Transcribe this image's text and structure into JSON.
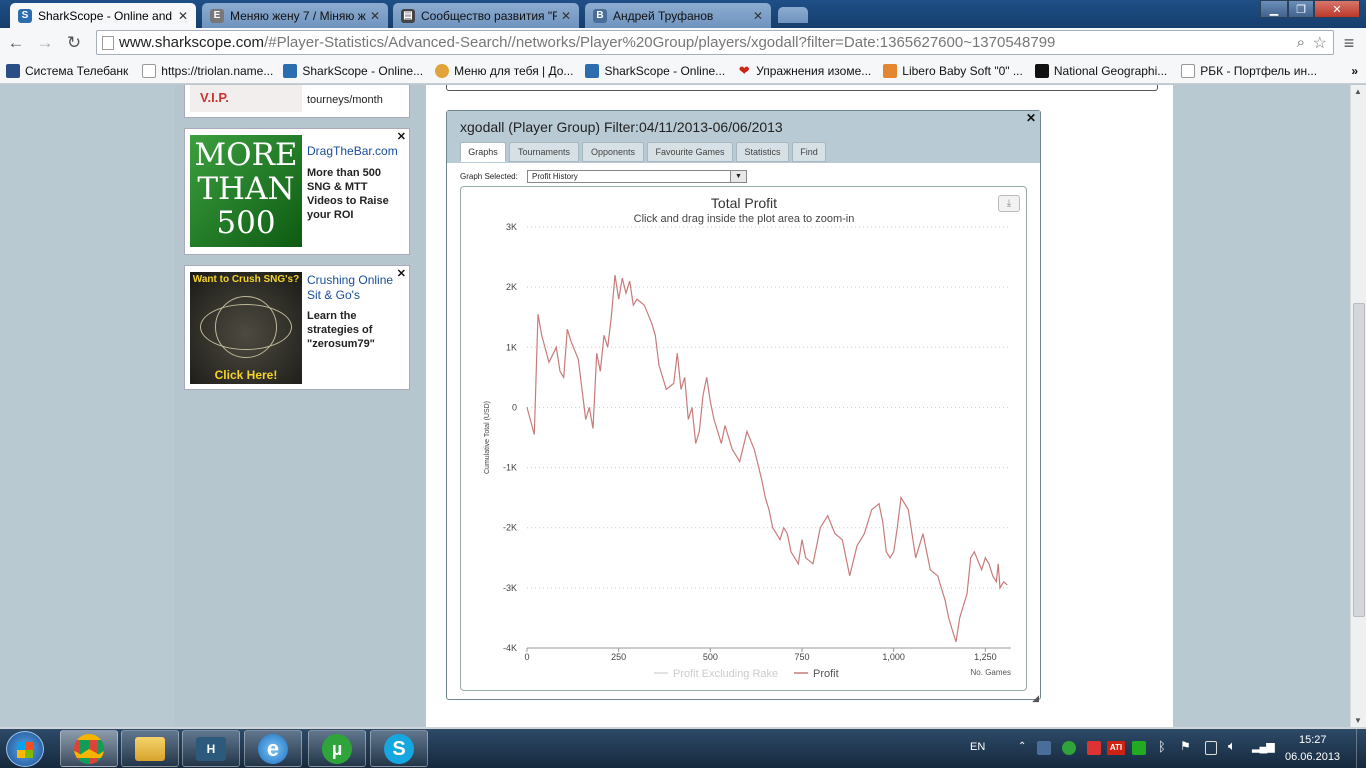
{
  "browser": {
    "tabs": [
      {
        "title": "SharkScope - Online and L",
        "active": true
      },
      {
        "title": "Меняю жену 7 / Міняю ж",
        "active": false
      },
      {
        "title": "Сообщество развития \"R",
        "active": false
      },
      {
        "title": "Андрей Труфанов",
        "active": false
      }
    ],
    "url_host": "www.sharkscope.com",
    "url_path": "/#Player-Statistics/Advanced-Search//networks/Player%20Group/players/xgodall?filter=Date:1365627600~1370548799",
    "bookmarks": [
      "Система Телебанк",
      "https://triolan.name...",
      "SharkScope - Online...",
      "Меню для тебя | До...",
      "SharkScope - Online...",
      "Упражнения изоме...",
      "Libero Baby Soft \"0\" ...",
      "National Geographi...",
      "РБК - Портфель ин..."
    ]
  },
  "ads": [
    {
      "title": "",
      "desc": "tourneys/month",
      "image_text": "V.I.P."
    },
    {
      "title": "DragTheBar.com",
      "desc": "More than 500 SNG & MTT Videos to Raise your ROI",
      "image_text": "MORE THAN 500"
    },
    {
      "title": "Crushing Online Sit & Go's",
      "desc": "Learn the strategies of \"zerosum79\"",
      "image_text_top": "Want to Crush SNG's?",
      "image_text_bottom": "Click Here!"
    }
  ],
  "panel": {
    "title": "xgodall (Player Group) Filter:04/11/2013-06/06/2013",
    "tabs": [
      "Graphs",
      "Tournaments",
      "Opponents",
      "Favourite Games",
      "Statistics",
      "Find"
    ],
    "graph_selected_label": "Graph Selected:",
    "graph_selected_value": "Profit History"
  },
  "chart_data": {
    "type": "line",
    "title": "Total Profit",
    "subtitle": "Click and drag inside the plot area to zoom-in",
    "ylabel": "Cumulative Total (USD)",
    "xlabel": "No. Games",
    "xlim": [
      0,
      1320
    ],
    "ylim": [
      -4000,
      3000
    ],
    "x_ticks": [
      "0",
      "250",
      "500",
      "750",
      "1,000",
      "1,250"
    ],
    "x_tick_values": [
      0,
      250,
      500,
      750,
      1000,
      1250
    ],
    "y_ticks": [
      "3K",
      "2K",
      "1K",
      "0",
      "-1K",
      "-2K",
      "-3K",
      "-4K"
    ],
    "y_tick_values": [
      3000,
      2000,
      1000,
      0,
      -1000,
      -2000,
      -3000,
      -4000
    ],
    "grid": true,
    "legend": "bottom-center",
    "series": [
      {
        "name": "Profit Excluding Rake",
        "color": "#d9d9d9",
        "x": [],
        "y": []
      },
      {
        "name": "Profit",
        "color": "#c87b7b",
        "x": [
          0,
          20,
          30,
          40,
          60,
          80,
          90,
          100,
          110,
          120,
          140,
          160,
          170,
          180,
          190,
          200,
          210,
          220,
          230,
          240,
          250,
          260,
          270,
          280,
          290,
          300,
          320,
          340,
          350,
          360,
          380,
          400,
          410,
          420,
          430,
          440,
          450,
          460,
          470,
          480,
          490,
          500,
          510,
          520,
          530,
          540,
          560,
          580,
          600,
          620,
          640,
          650,
          660,
          670,
          690,
          700,
          710,
          720,
          740,
          750,
          760,
          780,
          800,
          820,
          840,
          860,
          880,
          900,
          920,
          940,
          960,
          970,
          980,
          990,
          1000,
          1010,
          1020,
          1040,
          1050,
          1060,
          1070,
          1080,
          1100,
          1120,
          1130,
          1140,
          1150,
          1160,
          1170,
          1180,
          1190,
          1200,
          1210,
          1220,
          1240,
          1250,
          1260,
          1270,
          1280,
          1285,
          1290,
          1300,
          1310
        ],
        "y": [
          0,
          -450,
          1550,
          1200,
          750,
          1000,
          600,
          500,
          1300,
          1100,
          800,
          -200,
          0,
          -350,
          900,
          600,
          1200,
          1000,
          1500,
          2200,
          1800,
          2150,
          1900,
          2100,
          1700,
          1800,
          1700,
          1400,
          1200,
          700,
          300,
          400,
          900,
          300,
          500,
          -200,
          0,
          -600,
          -400,
          200,
          500,
          100,
          -200,
          -400,
          -600,
          -300,
          -700,
          -900,
          -400,
          -700,
          -1200,
          -1500,
          -1700,
          -2000,
          -2200,
          -2000,
          -2100,
          -2400,
          -2600,
          -2200,
          -2500,
          -2600,
          -2000,
          -1800,
          -2100,
          -2200,
          -2800,
          -2300,
          -2100,
          -1700,
          -1600,
          -1900,
          -2400,
          -2500,
          -2400,
          -2000,
          -1500,
          -1700,
          -2100,
          -2500,
          -2300,
          -2100,
          -2700,
          -2800,
          -3000,
          -3200,
          -3500,
          -3700,
          -3900,
          -3500,
          -3300,
          -3100,
          -2500,
          -2400,
          -2700,
          -2500,
          -2600,
          -2800,
          -2900,
          -2600,
          -3000,
          -2900,
          -2950
        ]
      }
    ]
  },
  "taskbar": {
    "lang": "EN",
    "time": "15:27",
    "date": "06.06.2013"
  }
}
